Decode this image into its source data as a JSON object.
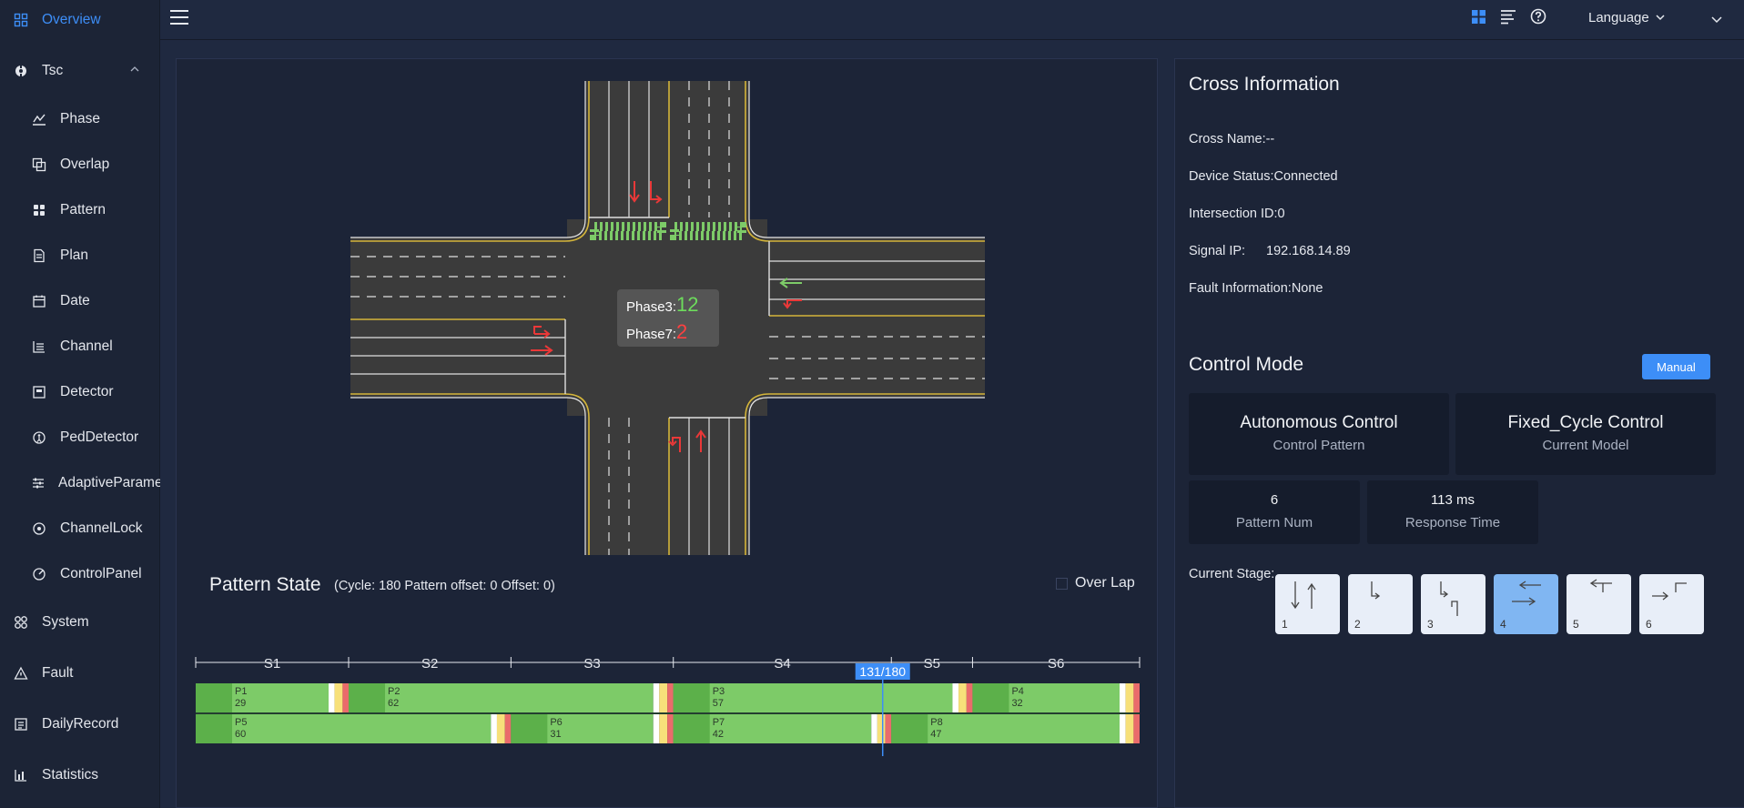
{
  "sidebar": {
    "overview": "Overview",
    "tsc": "Tsc",
    "tsc_items": [
      "Phase",
      "Overlap",
      "Pattern",
      "Plan",
      "Date",
      "Channel",
      "Detector",
      "PedDetector",
      "AdaptiveParame",
      "ChannelLock",
      "ControlPanel"
    ],
    "system": "System",
    "fault": "Fault",
    "daily": "DailyRecord",
    "statistics": "Statistics"
  },
  "header": {
    "language": "Language"
  },
  "intersection": {
    "phase_a_label": "Phase3:",
    "phase_a_value": "12",
    "phase_b_label": "Phase7:",
    "phase_b_value": "2"
  },
  "pattern_state": {
    "title": "Pattern State",
    "subtitle": "(Cycle: 180 Pattern offset: 0 Offset: 0)",
    "overlap": "Over Lap",
    "progress_label": "131/180",
    "cycle_progress": 0.7278,
    "stages": [
      {
        "label": "S1",
        "start": 0,
        "end": 0.162
      },
      {
        "label": "S2",
        "start": 0.162,
        "end": 0.334
      },
      {
        "label": "S3",
        "start": 0.334,
        "end": 0.506
      },
      {
        "label": "S4",
        "start": 0.506,
        "end": 0.737
      },
      {
        "label": "S5",
        "start": 0.737,
        "end": 0.823
      },
      {
        "label": "S6",
        "start": 0.823,
        "end": 1.0
      }
    ],
    "ring1": [
      {
        "name": "P1",
        "value": "29",
        "start": 0,
        "end": 0.162
      },
      {
        "name": "P2",
        "value": "62",
        "start": 0.162,
        "end": 0.506
      },
      {
        "name": "P3",
        "value": "57",
        "start": 0.506,
        "end": 0.823
      },
      {
        "name": "P4",
        "value": "32",
        "start": 0.823,
        "end": 1.0
      }
    ],
    "ring2": [
      {
        "name": "P5",
        "value": "60",
        "start": 0,
        "end": 0.334
      },
      {
        "name": "P6",
        "value": "31",
        "start": 0.334,
        "end": 0.506
      },
      {
        "name": "P7",
        "value": "42",
        "start": 0.506,
        "end": 0.737
      },
      {
        "name": "P8",
        "value": "47",
        "start": 0.737,
        "end": 1.0
      }
    ]
  },
  "cross_info": {
    "title": "Cross Information",
    "cross_name": "Cross Name:--",
    "device_status": "Device Status:Connected",
    "intersection_id": "Intersection ID:0",
    "signal_ip_label": "Signal IP:",
    "signal_ip_value": "192.168.14.89",
    "fault_info": "Fault Information:None"
  },
  "control_mode": {
    "title": "Control Mode",
    "manual_button": "Manual",
    "card1_value": "Autonomous Control",
    "card1_label": "Control Pattern",
    "card2_value": "Fixed_Cycle Control",
    "card2_label": "Current Model",
    "card3_value": "6",
    "card3_label": "Pattern Num",
    "card4_value": "113 ms",
    "card4_label": "Response Time",
    "current_stage_label": "Current Stage:",
    "stage_numbers": [
      "1",
      "2",
      "3",
      "4",
      "5",
      "6"
    ],
    "selected_stage": "4"
  },
  "colors": {
    "accent": "#3d8ef7",
    "green": "#7dcb68",
    "yellow": "#f7e07a",
    "red": "#ea6b6b"
  }
}
